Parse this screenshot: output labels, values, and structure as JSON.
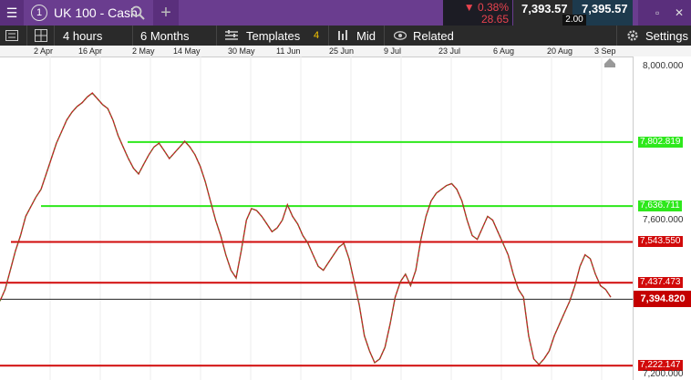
{
  "header": {
    "menu_icon": "hamburger-menu-icon",
    "tab_number": "1",
    "market_name": "UK 100 - Cash",
    "search_icon": "search-icon",
    "add_icon": "plus-icon",
    "change_pct": "0.38%",
    "change_points": "28.65",
    "sell_price": "7,393.57",
    "buy_price": "7,395.57",
    "spread": "2.00",
    "down_color": "#e8434e",
    "brand_color": "#6a3d8f"
  },
  "toolbar": {
    "interval": "4 hours",
    "range": "6 Months",
    "templates_label": "Templates",
    "templates_count": "4",
    "price_type": "Mid",
    "related_label": "Related",
    "settings_label": "Settings"
  },
  "date_axis": [
    "2 Apr",
    "16 Apr",
    "2 May",
    "14 May",
    "30 May",
    "11 Jun",
    "25 Jun",
    "9 Jul",
    "23 Jul",
    "6 Aug",
    "20 Aug",
    "3 Sep"
  ],
  "price_axis": {
    "labels": [
      "8,000.000",
      "7,600.000",
      "7,200.000"
    ],
    "current_price": "7,394.820"
  },
  "chart_data": {
    "type": "line",
    "ylim": [
      7185,
      8025
    ],
    "horizontal_lines": [
      {
        "value": 7802.819,
        "label": "7,802.819",
        "color": "#2ee81c"
      },
      {
        "value": 7636.711,
        "label": "7,636.711",
        "color": "#2ee81c"
      },
      {
        "value": 7543.55,
        "label": "7,543.550",
        "color": "#d10a0a"
      },
      {
        "value": 7437.473,
        "label": "7,437.473",
        "color": "#d10a0a"
      },
      {
        "value": 7222.147,
        "label": "7,222.147",
        "color": "#d10a0a"
      }
    ],
    "current_line": {
      "value": 7394.82,
      "color": "#222222",
      "label_bg": "#c40000"
    },
    "price_series": [
      7390,
      7420,
      7470,
      7520,
      7560,
      7610,
      7635,
      7660,
      7680,
      7720,
      7760,
      7800,
      7830,
      7860,
      7880,
      7895,
      7905,
      7920,
      7930,
      7915,
      7900,
      7890,
      7860,
      7820,
      7790,
      7760,
      7735,
      7720,
      7745,
      7770,
      7790,
      7800,
      7780,
      7760,
      7775,
      7790,
      7805,
      7790,
      7770,
      7740,
      7700,
      7650,
      7600,
      7560,
      7510,
      7470,
      7450,
      7520,
      7600,
      7630,
      7625,
      7610,
      7590,
      7570,
      7580,
      7600,
      7640,
      7610,
      7590,
      7560,
      7540,
      7510,
      7480,
      7470,
      7490,
      7510,
      7530,
      7540,
      7500,
      7440,
      7380,
      7300,
      7260,
      7230,
      7240,
      7270,
      7330,
      7400,
      7440,
      7460,
      7430,
      7470,
      7550,
      7610,
      7650,
      7670,
      7680,
      7690,
      7695,
      7680,
      7650,
      7600,
      7560,
      7550,
      7580,
      7610,
      7600,
      7570,
      7540,
      7510,
      7460,
      7420,
      7400,
      7300,
      7240,
      7225,
      7240,
      7260,
      7300,
      7330,
      7360,
      7390,
      7430,
      7480,
      7510,
      7500,
      7460,
      7430,
      7420,
      7400
    ]
  }
}
